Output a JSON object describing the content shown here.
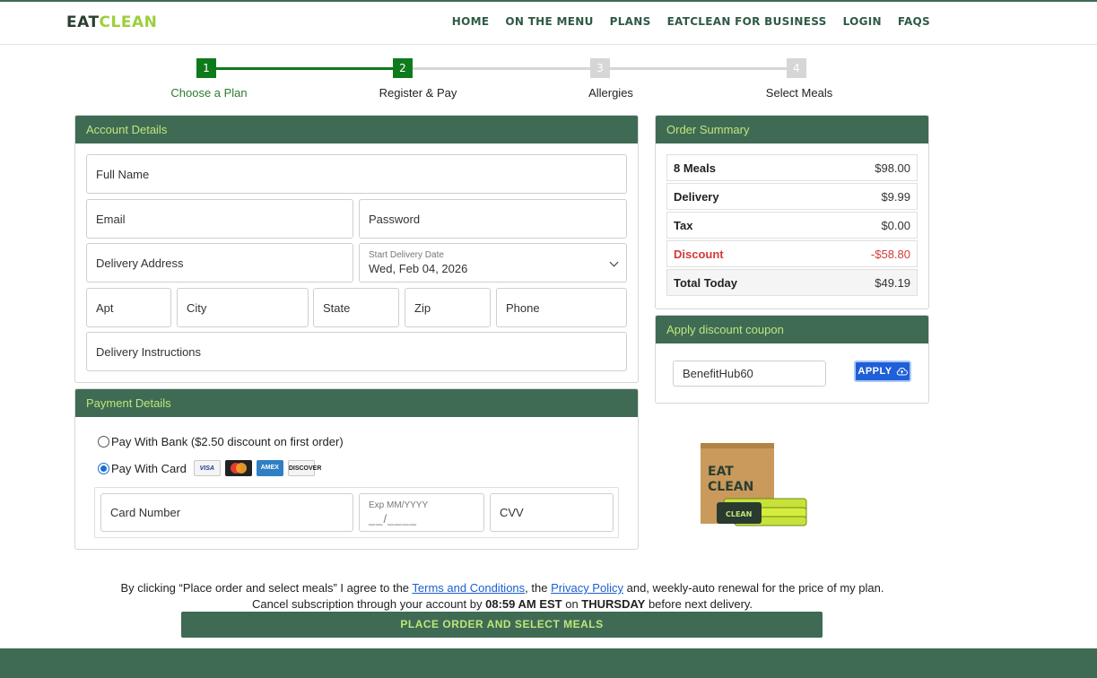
{
  "logo": {
    "eat": "EAT",
    "clean": "CLEAN"
  },
  "nav": [
    "HOME",
    "ON THE MENU",
    "PLANS",
    "EATCLEAN FOR BUSINESS",
    "LOGIN",
    "FAQS"
  ],
  "steps": [
    {
      "num": "1",
      "label": "Choose a Plan",
      "state": "done"
    },
    {
      "num": "2",
      "label": "Register & Pay",
      "state": "active"
    },
    {
      "num": "3",
      "label": "Allergies",
      "state": "inactive"
    },
    {
      "num": "4",
      "label": "Select Meals",
      "state": "inactive"
    }
  ],
  "account": {
    "title": "Account Details",
    "full_name": "Full Name",
    "email": "Email",
    "password": "Password",
    "delivery_address": "Delivery Address",
    "start_date_label": "Start Delivery Date",
    "start_date_value": "Wed, Feb 04, 2026",
    "apt": "Apt",
    "city": "City",
    "state": "State",
    "zip": "Zip",
    "phone": "Phone",
    "instructions": "Delivery Instructions"
  },
  "payment": {
    "title": "Payment Details",
    "bank_option": "Pay With Bank ($2.50 discount on first order)",
    "card_option": "Pay With Card",
    "card_icons": [
      "VISA",
      "MC",
      "AMEX",
      "DISCOVER"
    ],
    "card_number": "Card Number",
    "exp_label": "Exp MM/YYYY",
    "exp_mask": "__/____",
    "cvv": "CVV"
  },
  "summary": {
    "title": "Order Summary",
    "rows": [
      {
        "label": "8 Meals",
        "value": "$98.00"
      },
      {
        "label": "Delivery",
        "value": "$9.99"
      },
      {
        "label": "Tax",
        "value": "$0.00"
      },
      {
        "label": "Discount",
        "value": "-$58.80"
      },
      {
        "label": "Total Today",
        "value": "$49.19"
      }
    ]
  },
  "coupon": {
    "title": "Apply discount coupon",
    "value": "BenefitHub60",
    "apply": "APPLY"
  },
  "product": {
    "box_text_1": "EAT",
    "box_text_2": "CLEAN"
  },
  "terms": {
    "t1": "By clicking “Place order and select meals” I agree to the ",
    "link1": "Terms and Conditions",
    "t2": ", the ",
    "link2": "Privacy Policy",
    "t3": " and, weekly-auto renewal for the price of my plan.",
    "t4": "Cancel subscription through your account by ",
    "time": "08:59 AM EST",
    "t5": " on ",
    "day": "THURSDAY",
    "t6": " before next delivery."
  },
  "place_order": "PLACE ORDER AND SELECT MEALS",
  "colors": {
    "brand_green": "#3f6b55",
    "accent_lime": "#bfe67a",
    "step_green": "#0f7a1c",
    "discount_red": "#d33a3a",
    "apply_blue": "#1f5fd8"
  }
}
